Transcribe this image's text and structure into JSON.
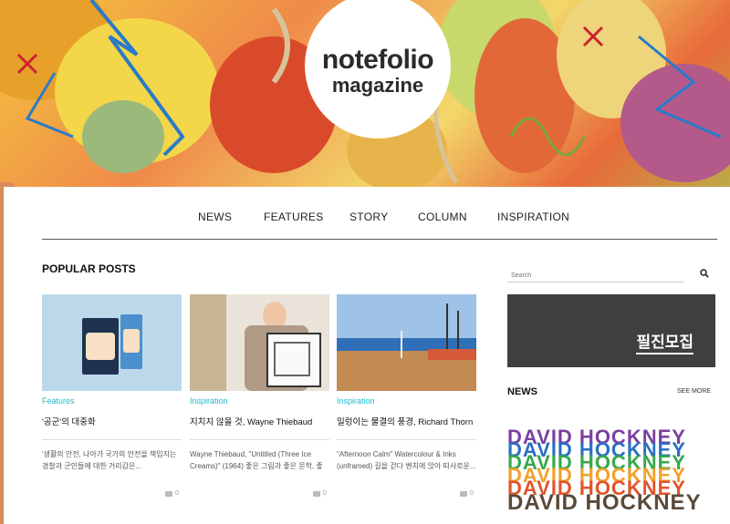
{
  "brand": {
    "logo_line1": "notefolio",
    "logo_line2": "magazine"
  },
  "nav": {
    "items": [
      "NEWS",
      "FEATURES",
      "STORY",
      "COLUMN",
      "INSPIRATION"
    ]
  },
  "popular": {
    "title": "POPULAR POSTS",
    "posts": [
      {
        "category": "Features",
        "title": "'공군'의 대중화",
        "excerpt": "'생활의 안전, 나아가 국가의 안전을 책임지는 경찰과 군인들에 대한 거리감은...",
        "comments": "0"
      },
      {
        "category": "Inspiration",
        "title": "지치지 않을 것, Wayne Thiebaud",
        "excerpt": "Wayne Thiebaud, \"Untitled (Three Ice Creams)\" (1964) 좋은 그림과 좋은 문학, 좋은...",
        "comments": "0"
      },
      {
        "category": "Inspiration",
        "title": "일렁이는 물결의 풍경, Richard Thorn",
        "excerpt": "\"Afternoon Calm\" Watercolour & Inks (unframed) 길을 걷다 벤치에 앉아 따사로운...",
        "comments": "0"
      }
    ]
  },
  "sidebar": {
    "search_placeholder": "Search",
    "recruit_label": "필진모집",
    "news_title": "NEWS",
    "see_more": "SEE MORE",
    "news_image_text": "DAVID HOCKNEY"
  },
  "colors": {
    "accent": "#22b8c8",
    "recruit_bg": "#3f3f3f"
  }
}
